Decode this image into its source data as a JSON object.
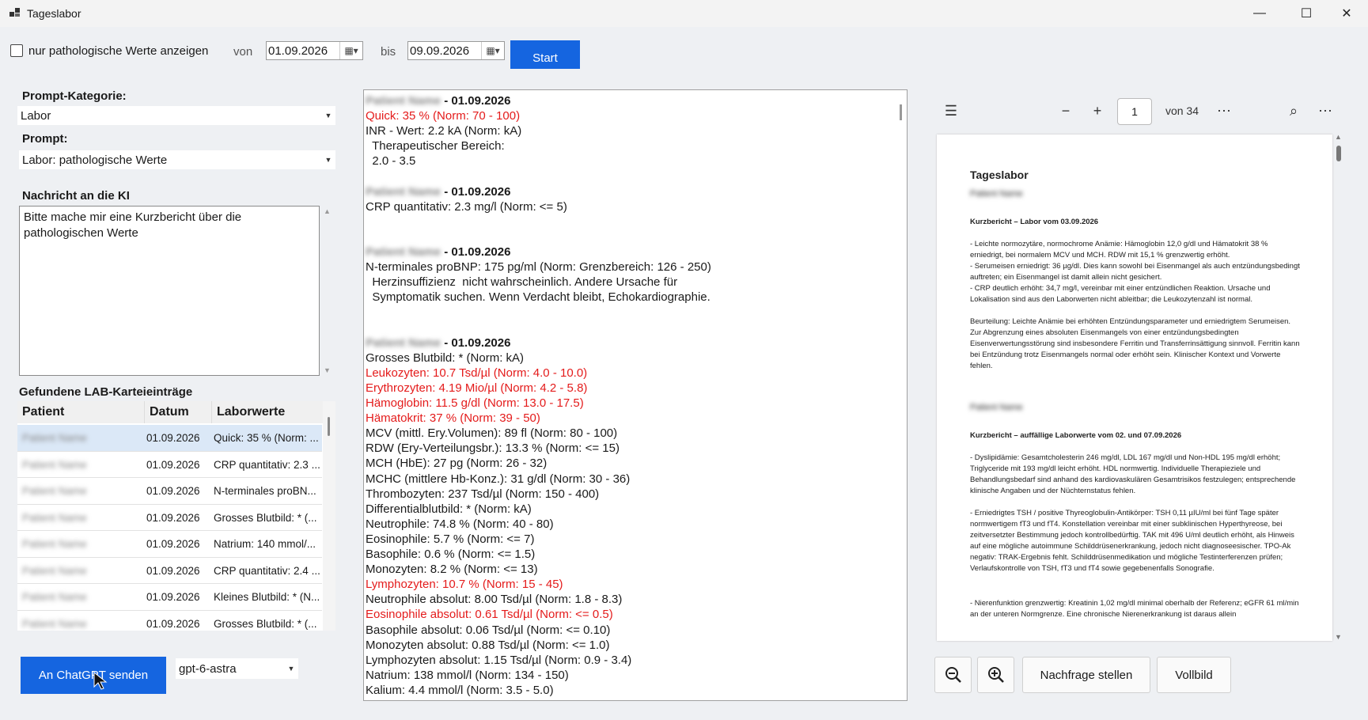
{
  "window": {
    "title": "Tageslabor",
    "min_glyph": "—",
    "max_glyph": "☐",
    "close_glyph": "✕"
  },
  "toolbar": {
    "pathological_only_label": "nur pathologische Werte anzeigen",
    "von_label": "von",
    "von_date": "01.09.2026",
    "bis_label": "bis",
    "bis_date": "09.09.2026",
    "start_label": "Start"
  },
  "left": {
    "category_heading": "Prompt-Kategorie:",
    "category_value": "Labor",
    "prompt_heading": "Prompt:",
    "prompt_value": "Labor: pathologische Werte",
    "message_heading": "Nachricht an die KI",
    "message_text": "Bitte mache mir eine Kurzbericht über die pathologischen Werte",
    "entries_heading": "Gefundene LAB-Karteieinträge",
    "columns": [
      "Patient",
      "Datum",
      "Laborwerte"
    ],
    "rows": [
      {
        "patient": "Patient Name",
        "date": "01.09.2026",
        "values": "Quick: 35 % (Norm: ..."
      },
      {
        "patient": "Patient Name",
        "date": "01.09.2026",
        "values": "CRP quantitativ: 2.3 ..."
      },
      {
        "patient": "Patient Name",
        "date": "01.09.2026",
        "values": "N-terminales proBN..."
      },
      {
        "patient": "Patient Name",
        "date": "01.09.2026",
        "values": "Grosses Blutbild: * (..."
      },
      {
        "patient": "Patient Name",
        "date": "01.09.2026",
        "values": "Natrium: 140 mmol/..."
      },
      {
        "patient": "Patient Name",
        "date": "01.09.2026",
        "values": "CRP quantitativ: 2.4 ..."
      },
      {
        "patient": "Patient Name",
        "date": "01.09.2026",
        "values": "Kleines Blutbild: * (N..."
      },
      {
        "patient": "Patient Name",
        "date": "01.09.2026",
        "values": "Grosses Blutbild: * (..."
      }
    ],
    "send_label": "An ChatGPT senden",
    "model_value": "gpt-6-astra"
  },
  "report": {
    "lines": [
      {
        "t": "Patient Name",
        "blur": true,
        "suffix": " - 01.09.2026"
      },
      {
        "t": "Quick: 35 % (Norm: 70 - 100)",
        "red": true
      },
      {
        "t": "INR - Wert: 2.2 kA (Norm: kA)"
      },
      {
        "t": "  Therapeutischer Bereich:"
      },
      {
        "t": "  2.0 - 3.5"
      },
      {
        "t": ""
      },
      {
        "t": "Patient Name",
        "blur": true,
        "suffix": " - 01.09.2026"
      },
      {
        "t": "CRP quantitativ: 2.3 mg/l (Norm: <= 5)"
      },
      {
        "t": ""
      },
      {
        "t": ""
      },
      {
        "t": "Patient Name",
        "blur": true,
        "suffix": " - 01.09.2026"
      },
      {
        "t": "N-terminales proBNP: 175 pg/ml (Norm: Grenzbereich: 126 - 250)"
      },
      {
        "t": "  Herzinsuffizienz  nicht wahrscheinlich. Andere Ursache für"
      },
      {
        "t": "  Symptomatik suchen. Wenn Verdacht bleibt, Echokardiographie."
      },
      {
        "t": ""
      },
      {
        "t": ""
      },
      {
        "t": "Patient Name",
        "blur": true,
        "suffix": " - 01.09.2026"
      },
      {
        "t": "Grosses Blutbild: * (Norm: kA)"
      },
      {
        "t": "Leukozyten: 10.7 Tsd/µl (Norm: 4.0 - 10.0)",
        "red": true
      },
      {
        "t": "Erythrozyten: 4.19 Mio/µl (Norm: 4.2 - 5.8)",
        "red": true
      },
      {
        "t": "Hämoglobin: 11.5 g/dl (Norm: 13.0 - 17.5)",
        "red": true
      },
      {
        "t": "Hämatokrit: 37 % (Norm: 39 - 50)",
        "red": true
      },
      {
        "t": "MCV (mittl. Ery.Volumen): 89 fl (Norm: 80 - 100)"
      },
      {
        "t": "RDW (Ery-Verteilungsbr.): 13.3 % (Norm: <= 15)"
      },
      {
        "t": "MCH (HbE): 27 pg (Norm: 26 - 32)"
      },
      {
        "t": "MCHC (mittlere Hb-Konz.): 31 g/dl (Norm: 30 - 36)"
      },
      {
        "t": "Thrombozyten: 237 Tsd/µl (Norm: 150 - 400)"
      },
      {
        "t": "Differentialblutbild: * (Norm: kA)"
      },
      {
        "t": "Neutrophile: 74.8 % (Norm: 40 - 80)"
      },
      {
        "t": "Eosinophile: 5.7 % (Norm: <= 7)"
      },
      {
        "t": "Basophile: 0.6 % (Norm: <= 1.5)"
      },
      {
        "t": "Monozyten: 8.2 % (Norm: <= 13)"
      },
      {
        "t": "Lymphozyten: 10.7 % (Norm: 15 - 45)",
        "red": true
      },
      {
        "t": "Neutrophile absolut: 8.00 Tsd/µl (Norm: 1.8 - 8.3)"
      },
      {
        "t": "Eosinophile absolut: 0.61 Tsd/µl (Norm: <= 0.5)",
        "red": true
      },
      {
        "t": "Basophile absolut: 0.06 Tsd/µl (Norm: <= 0.10)"
      },
      {
        "t": "Monozyten absolut: 0.88 Tsd/µl (Norm: <= 1.0)"
      },
      {
        "t": "Lymphozyten absolut: 1.15 Tsd/µl (Norm: 0.9 - 3.4)"
      },
      {
        "t": "Natrium: 138 mmol/l (Norm: 134 - 150)"
      },
      {
        "t": "Kalium: 4.4 mmol/l (Norm: 3.5 - 5.0)"
      }
    ]
  },
  "pdf": {
    "page": "1",
    "of_pages": "von 34",
    "title": "Tageslabor",
    "blur_name1": "Patient Name",
    "h1": "Kurzbericht – Labor vom 03.09.2026",
    "p1": [
      "- Leichte normozytäre, normochrome Anämie: Hämoglobin 12,0 g/dl und Hämatokrit 38 % erniedrigt, bei normalem MCV und MCH. RDW mit 15,1 % grenzwertig erhöht.",
      "- Serumeisen erniedrigt: 36 µg/dl. Dies kann sowohl bei Eisenmangel als auch entzündungsbedingt auftreten; ein Eisenmangel ist damit allein nicht gesichert.",
      "- CRP deutlich erhöht: 34,7 mg/l, vereinbar mit einer entzündlichen Reaktion. Ursache und Lokalisation sind aus den Laborwerten nicht ableitbar; die Leukozytenzahl ist normal."
    ],
    "p2": "Beurteilung: Leichte Anämie bei erhöhten Entzündungsparameter und erniedrigtem Serumeisen. Zur Abgrenzung eines absoluten Eisenmangels von einer entzündungsbedingten Eisenverwertungsstörung sind insbesondere Ferritin und Transferrinsättigung sinnvoll. Ferritin kann bei Entzündung trotz Eisenmangels normal oder erhöht sein. Klinischer Kontext und Vorwerte fehlen.",
    "blur_name2": "Patient Name",
    "h2": "Kurzbericht – auffällige Laborwerte vom 02. und 07.09.2026",
    "p3": "- Dyslipidämie: Gesamtcholesterin 246 mg/dl, LDL 167 mg/dl und Non-HDL 195 mg/dl erhöht; Triglyceride mit 193 mg/dl leicht erhöht. HDL normwertig. Individuelle Therapieziele und Behandlungsbedarf sind anhand des kardiovaskulären Gesamtrisikos festzulegen; entsprechende klinische Angaben und der Nüchternstatus fehlen.",
    "p4": "- Erniedrigtes TSH / positive Thyreoglobulin-Antikörper: TSH 0,11 µIU/ml bei fünf Tage später normwertigem fT3 und fT4. Konstellation vereinbar mit einer subklinischen Hyperthyreose, bei zeitversetzter Bestimmung jedoch kontrollbedürftig. TAK mit 496 U/ml deutlich erhöht, als Hinweis auf eine mögliche autoimmune Schilddrüsenerkrankung, jedoch nicht diagnoseesischer. TPO-Ak negativ: TRAK-Ergebnis fehlt. Schilddrüsenmedikation und mögliche Testinterferenzen prüfen; Verlaufskontrolle von TSH, fT3 und fT4 sowie gegebenenfalls Sonografie.",
    "p5": "- Nierenfunktion grenzwertig: Kreatinin 1,02 mg/dl minimal oberhalb der Referenz; eGFR 61 ml/min an der unteren Normgrenze. Eine chronische Nierenerkrankung ist daraus allein"
  },
  "bottom": {
    "ask_label": "Nachfrage stellen",
    "fullscreen_label": "Vollbild"
  }
}
